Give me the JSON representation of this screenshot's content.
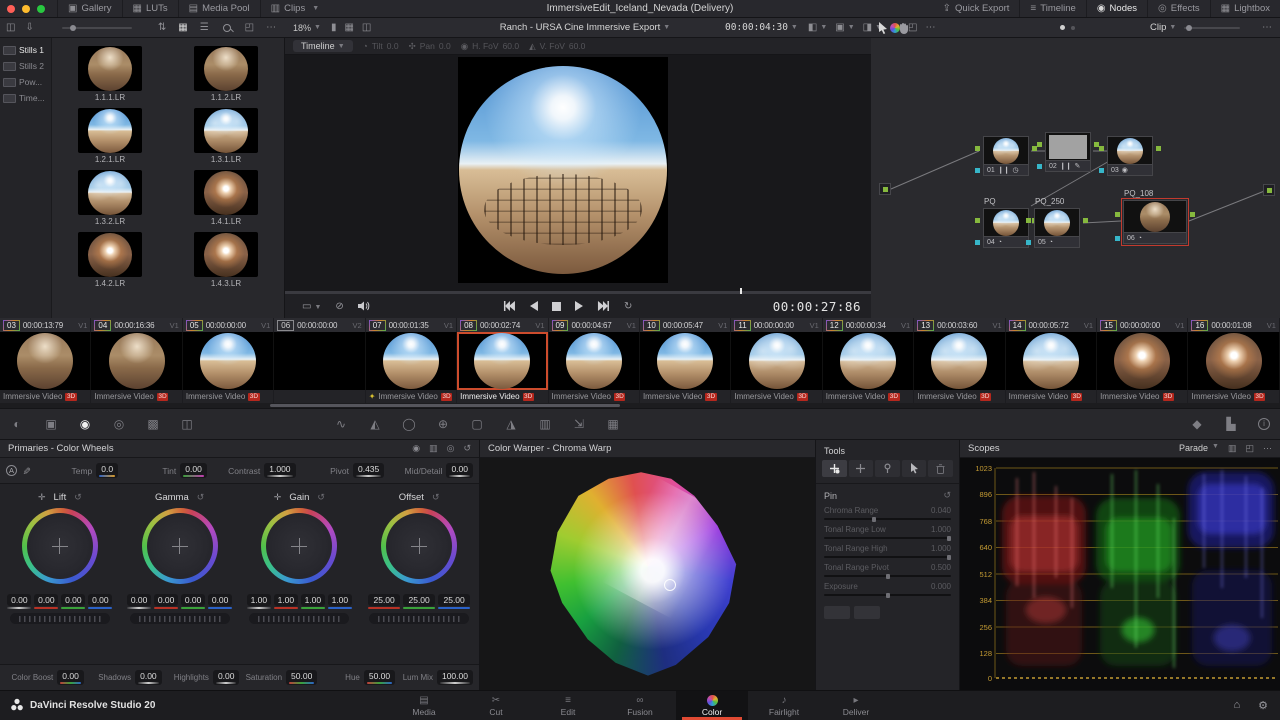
{
  "colors": {
    "accent_red": "#e04a33",
    "selection_orange": "#cd4c2d",
    "badge_3d_red": "#b5271d",
    "scope_scale_yellow": "#c49b33",
    "node_port_green": "#86b93e",
    "node_port_cyan": "#37b6c9"
  },
  "titlebar": {
    "title": "ImmersiveEdit_Iceland_Nevada (Delivery)",
    "left_buttons": [
      {
        "label": "Gallery"
      },
      {
        "label": "LUTs"
      },
      {
        "label": "Media Pool"
      },
      {
        "label": "Clips"
      }
    ],
    "right_buttons": [
      {
        "label": "Quick Export"
      },
      {
        "label": "Timeline"
      },
      {
        "label": "Nodes"
      },
      {
        "label": "Effects"
      },
      {
        "label": "Lightbox"
      }
    ]
  },
  "gallery": {
    "sidebar": [
      {
        "label": "Stills 1"
      },
      {
        "label": "Stills 2"
      },
      {
        "label": "Pow..."
      },
      {
        "label": "Time..."
      }
    ],
    "stills": [
      {
        "label": "1.1.1.LR"
      },
      {
        "label": "1.1.2.LR"
      },
      {
        "label": "1.2.1.LR"
      },
      {
        "label": "1.3.1.LR"
      },
      {
        "label": "1.3.2.LR"
      },
      {
        "label": "1.4.1.LR"
      },
      {
        "label": "1.4.2.LR"
      },
      {
        "label": "1.4.3.LR"
      }
    ]
  },
  "viewer": {
    "zoom": "18%",
    "timeline_name": "Ranch - URSA Cine Immersive Export",
    "clip_timecode": "00:00:04:30",
    "mode_selector": "Timeline",
    "immersive_controls": [
      {
        "label": "Tilt",
        "value": "0.0"
      },
      {
        "label": "Pan",
        "value": "0.0"
      },
      {
        "label": "H. FoV",
        "value": "60.0"
      },
      {
        "label": "V. FoV",
        "value": "60.0"
      }
    ],
    "playhead_timecode": "00:00:27:86"
  },
  "nodes_panel": {
    "selector": "Clip",
    "nodes": [
      {
        "num": "01",
        "label": ""
      },
      {
        "num": "02",
        "label": ""
      },
      {
        "num": "03",
        "label": ""
      },
      {
        "num": "04",
        "label": "PQ"
      },
      {
        "num": "05",
        "label": "PQ_250"
      },
      {
        "num": "06",
        "label": "PQ_108"
      }
    ]
  },
  "timeline": {
    "clips": [
      {
        "num": "03",
        "timecode": "00:00:13:79",
        "track": "V1",
        "label": "Immersive Video",
        "badge": "3D"
      },
      {
        "num": "04",
        "timecode": "00:00:16:36",
        "track": "V1",
        "label": "Immersive Video",
        "badge": "3D"
      },
      {
        "num": "05",
        "timecode": "00:00:00:00",
        "track": "V1",
        "label": "Immersive Video",
        "badge": "3D"
      },
      {
        "num": "06",
        "timecode": "00:00:00:00",
        "track": "V2",
        "label": "",
        "badge": ""
      },
      {
        "num": "07",
        "timecode": "00:00:01:35",
        "track": "V1",
        "label": "Immersive Video",
        "badge": "3D"
      },
      {
        "num": "08",
        "timecode": "00:00:02:74",
        "track": "V1",
        "label": "Immersive Video",
        "badge": "3D"
      },
      {
        "num": "09",
        "timecode": "00:00:04:67",
        "track": "V1",
        "label": "Immersive Video",
        "badge": "3D"
      },
      {
        "num": "10",
        "timecode": "00:00:05:47",
        "track": "V1",
        "label": "Immersive Video",
        "badge": "3D"
      },
      {
        "num": "11",
        "timecode": "00:00:00:00",
        "track": "V1",
        "label": "Immersive Video",
        "badge": "3D"
      },
      {
        "num": "12",
        "timecode": "00:00:00:34",
        "track": "V1",
        "label": "Immersive Video",
        "badge": "3D"
      },
      {
        "num": "13",
        "timecode": "00:00:03:60",
        "track": "V1",
        "label": "Immersive Video",
        "badge": "3D"
      },
      {
        "num": "14",
        "timecode": "00:00:05:72",
        "track": "V1",
        "label": "Immersive Video",
        "badge": "3D"
      },
      {
        "num": "15",
        "timecode": "00:00:00:00",
        "track": "V1",
        "label": "Immersive Video",
        "badge": "3D"
      },
      {
        "num": "16",
        "timecode": "00:00:01:08",
        "track": "V1",
        "label": "Immersive Video",
        "badge": "3D"
      }
    ]
  },
  "primaries": {
    "title": "Primaries - Color Wheels",
    "adjustments": [
      {
        "label": "Temp",
        "value": "0.0"
      },
      {
        "label": "Tint",
        "value": "0.00"
      },
      {
        "label": "Contrast",
        "value": "1.000"
      },
      {
        "label": "Pivot",
        "value": "0.435"
      },
      {
        "label": "Mid/Detail",
        "value": "0.00"
      }
    ],
    "wheels": [
      {
        "name": "Lift",
        "values": [
          "0.00",
          "0.00",
          "0.00",
          "0.00"
        ]
      },
      {
        "name": "Gamma",
        "values": [
          "0.00",
          "0.00",
          "0.00",
          "0.00"
        ]
      },
      {
        "name": "Gain",
        "values": [
          "1.00",
          "1.00",
          "1.00",
          "1.00"
        ]
      },
      {
        "name": "Offset",
        "values": [
          "25.00",
          "25.00",
          "25.00"
        ]
      }
    ],
    "bottom_adjustments": [
      {
        "label": "Color Boost",
        "value": "0.00"
      },
      {
        "label": "Shadows",
        "value": "0.00"
      },
      {
        "label": "Highlights",
        "value": "0.00"
      },
      {
        "label": "Saturation",
        "value": "50.00"
      },
      {
        "label": "Hue",
        "value": "50.00"
      },
      {
        "label": "Lum Mix",
        "value": "100.00"
      }
    ]
  },
  "warper": {
    "title": "Color Warper - Chroma Warp",
    "tools_title": "Tools",
    "pin_label": "Pin",
    "sliders": [
      {
        "label": "Chroma Range",
        "value": "0.040"
      },
      {
        "label": "Tonal Range Low",
        "value": "1.000"
      },
      {
        "label": "Tonal Range High",
        "value": "1.000"
      },
      {
        "label": "Tonal Range Pivot",
        "value": "0.500"
      },
      {
        "label": "Exposure",
        "value": "0.000"
      }
    ]
  },
  "scopes": {
    "title": "Scopes",
    "mode": "Parade",
    "scale": [
      "1023",
      "896",
      "768",
      "640",
      "512",
      "384",
      "256",
      "128",
      "0"
    ]
  },
  "bottombar": {
    "app_name": "DaVinci Resolve Studio 20",
    "pages": [
      {
        "label": "Media"
      },
      {
        "label": "Cut"
      },
      {
        "label": "Edit"
      },
      {
        "label": "Fusion"
      },
      {
        "label": "Color"
      },
      {
        "label": "Fairlight"
      },
      {
        "label": "Deliver"
      }
    ]
  }
}
